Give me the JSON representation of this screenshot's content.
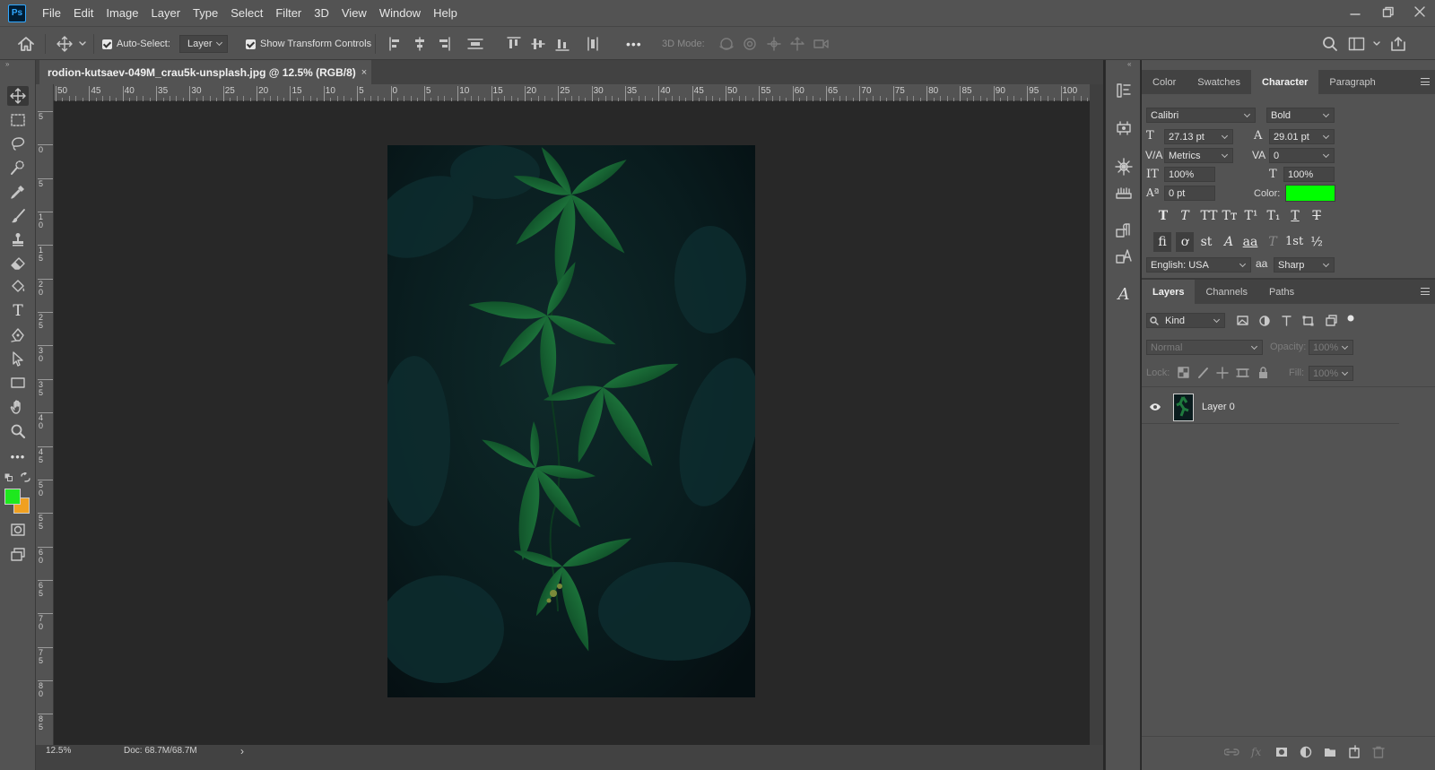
{
  "app": {
    "logo": "Ps"
  },
  "menu": [
    "File",
    "Edit",
    "Image",
    "Layer",
    "Type",
    "Select",
    "Filter",
    "3D",
    "View",
    "Window",
    "Help"
  ],
  "options_bar": {
    "auto_select_label": "Auto-Select:",
    "auto_select_target": "Layer",
    "transform_label": "Show Transform Controls",
    "more": "•••",
    "mode_3d_label": "3D Mode:"
  },
  "document": {
    "tab_title": "rodion-kutsaev-049M_crau5k-unsplash.jpg @ 12.5% (RGB/8)",
    "tab_close": "×",
    "zoom": "12.5%",
    "doc_info": "Doc: 68.7M/68.7M",
    "status_arrow": "›"
  },
  "ruler_h": [
    "50",
    "45",
    "40",
    "35",
    "30",
    "25",
    "20",
    "15",
    "10",
    "5",
    "0",
    "5",
    "10",
    "15",
    "20",
    "25",
    "30",
    "35",
    "40",
    "45",
    "50",
    "55",
    "60",
    "65",
    "70",
    "75",
    "80",
    "85",
    "90",
    "95",
    "100",
    "1"
  ],
  "ruler_v": [
    "5",
    "0",
    "5",
    "1 0",
    "1 5",
    "2 0",
    "2 5",
    "3 0",
    "3 5",
    "4 0",
    "4 5",
    "5 0",
    "5 5",
    "6 0",
    "6 5",
    "7 0",
    "7 5",
    "8 0",
    "8 5"
  ],
  "character_panel": {
    "tabs": [
      "Color",
      "Swatches",
      "Character",
      "Paragraph"
    ],
    "active_tab": "Character",
    "font_family": "Calibri",
    "font_style": "Bold",
    "font_size": "27.13 pt",
    "leading": "29.01 pt",
    "kerning": "Metrics",
    "tracking": "0",
    "vertical_scale": "100%",
    "horizontal_scale": "100%",
    "baseline_shift": "0 pt",
    "color_label": "Color:",
    "text_color": "#00ff00",
    "language": "English: USA",
    "antialias_symbol": "aa",
    "antialias": "Sharp",
    "style_buttons": [
      "T",
      "T",
      "TT",
      "Tт",
      "T¹",
      "T₁",
      "T",
      "T"
    ],
    "opentype_buttons": [
      "fi",
      "ơ",
      "st",
      "A",
      "aa",
      "T",
      "1st",
      "½"
    ]
  },
  "layers_panel": {
    "tabs": [
      "Layers",
      "Channels",
      "Paths"
    ],
    "active_tab": "Layers",
    "filter_kind": "Kind",
    "blend_mode": "Normal",
    "opacity_label": "Opacity:",
    "opacity": "100%",
    "lock_label": "Lock:",
    "fill_label": "Fill:",
    "fill": "100%",
    "layers": [
      {
        "name": "Layer 0",
        "visible": true
      }
    ]
  },
  "colors": {
    "foreground": "#1ee81e",
    "background": "#f0a020",
    "accent": "#31a8ff"
  }
}
